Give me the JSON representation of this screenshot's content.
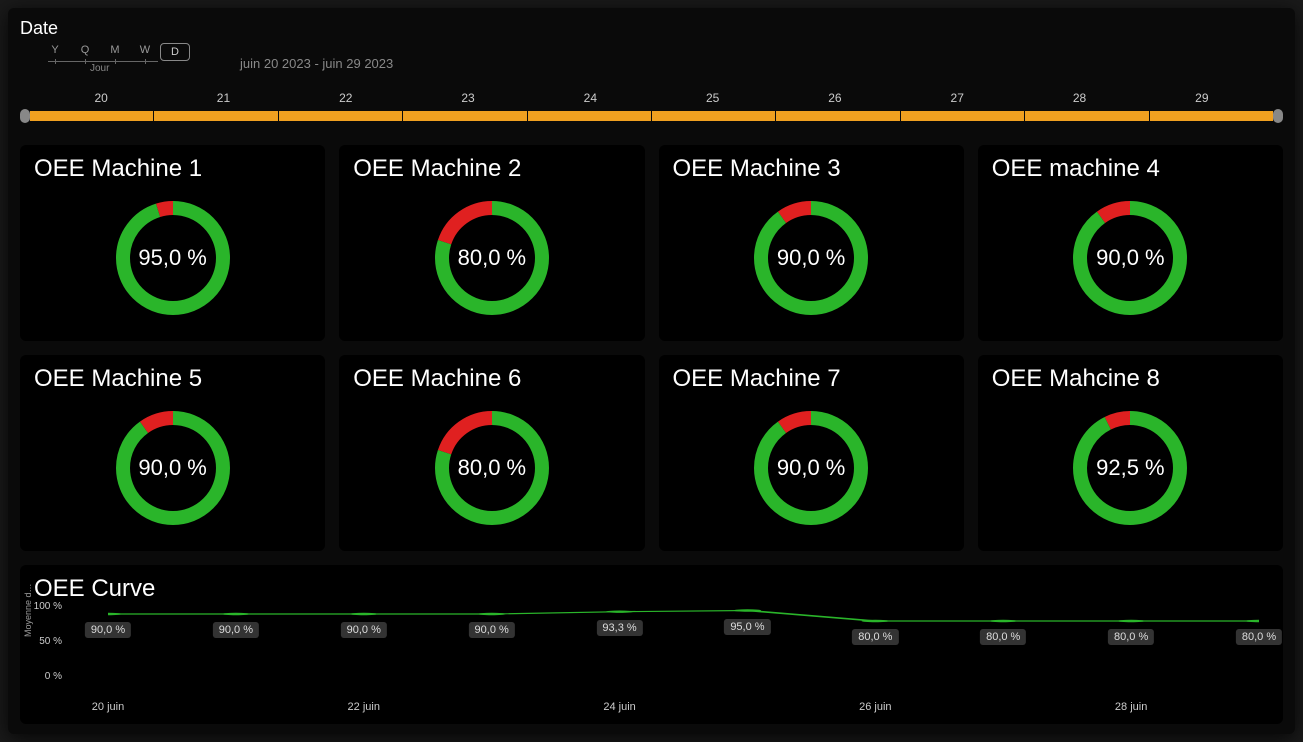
{
  "date_section": {
    "title": "Date",
    "granularity": [
      "Y",
      "Q",
      "M",
      "W",
      "D"
    ],
    "granularity_active": "D",
    "granularity_label": "Jour",
    "range_text": "juin 20 2023 - juin 29 2023",
    "timeline_days": [
      "20",
      "21",
      "22",
      "23",
      "24",
      "25",
      "26",
      "27",
      "28",
      "29"
    ]
  },
  "gauges": [
    {
      "title": "OEE Machine 1",
      "value": 95.0,
      "display": "95,0 %"
    },
    {
      "title": "OEE Machine 2",
      "value": 80.0,
      "display": "80,0 %"
    },
    {
      "title": "OEE Machine 3",
      "value": 90.0,
      "display": "90,0 %"
    },
    {
      "title": "OEE machine 4",
      "value": 90.0,
      "display": "90,0 %"
    },
    {
      "title": "OEE Machine 5",
      "value": 90.0,
      "display": "90,0 %"
    },
    {
      "title": "OEE Machine 6",
      "value": 80.0,
      "display": "80,0 %"
    },
    {
      "title": "OEE Machine 7",
      "value": 90.0,
      "display": "90,0 %"
    },
    {
      "title": "OEE Mahcine 8",
      "value": 92.5,
      "display": "92,5 %"
    }
  ],
  "curve": {
    "title": "OEE Curve",
    "ylabel": "Moyenne d…",
    "yticks": [
      {
        "label": "100 %",
        "value": 100
      },
      {
        "label": "50 %",
        "value": 50
      },
      {
        "label": "0 %",
        "value": 0
      }
    ],
    "xticks": [
      "20 juin",
      "22 juin",
      "24 juin",
      "26 juin",
      "28 juin"
    ]
  },
  "chart_data": {
    "gauges": [
      {
        "type": "donut",
        "title": "OEE Machine 1",
        "value": 95.0,
        "max": 100,
        "colors": {
          "fill": "#2ab52a",
          "remain": "#e02020"
        }
      },
      {
        "type": "donut",
        "title": "OEE Machine 2",
        "value": 80.0,
        "max": 100,
        "colors": {
          "fill": "#2ab52a",
          "remain": "#e02020"
        }
      },
      {
        "type": "donut",
        "title": "OEE Machine 3",
        "value": 90.0,
        "max": 100,
        "colors": {
          "fill": "#2ab52a",
          "remain": "#e02020"
        }
      },
      {
        "type": "donut",
        "title": "OEE machine 4",
        "value": 90.0,
        "max": 100,
        "colors": {
          "fill": "#2ab52a",
          "remain": "#e02020"
        }
      },
      {
        "type": "donut",
        "title": "OEE Machine 5",
        "value": 90.0,
        "max": 100,
        "colors": {
          "fill": "#2ab52a",
          "remain": "#e02020"
        }
      },
      {
        "type": "donut",
        "title": "OEE Machine 6",
        "value": 80.0,
        "max": 100,
        "colors": {
          "fill": "#2ab52a",
          "remain": "#e02020"
        }
      },
      {
        "type": "donut",
        "title": "OEE Machine 7",
        "value": 90.0,
        "max": 100,
        "colors": {
          "fill": "#2ab52a",
          "remain": "#e02020"
        }
      },
      {
        "type": "donut",
        "title": "OEE Mahcine 8",
        "value": 92.5,
        "max": 100,
        "colors": {
          "fill": "#2ab52a",
          "remain": "#e02020"
        }
      }
    ],
    "line": {
      "type": "line",
      "title": "OEE Curve",
      "xlabel": "",
      "ylabel": "Moyenne d…",
      "ylim": [
        0,
        100
      ],
      "x": [
        "20 juin",
        "21 juin",
        "22 juin",
        "23 juin",
        "24 juin",
        "25 juin",
        "26 juin",
        "27 juin",
        "28 juin",
        "29 juin"
      ],
      "series": [
        {
          "name": "OEE",
          "values": [
            90.0,
            90.0,
            90.0,
            90.0,
            93.3,
            95.0,
            80.0,
            80.0,
            80.0,
            80.0
          ],
          "labels": [
            "90,0 %",
            "90,0 %",
            "90,0 %",
            "90,0 %",
            "93,3 %",
            "95,0 %",
            "80,0 %",
            "80,0 %",
            "80,0 %",
            "80,0 %"
          ],
          "color": "#2ab52a"
        }
      ]
    }
  },
  "colors": {
    "accent": "#f0a020",
    "green": "#2ab52a",
    "red": "#e02020",
    "bg": "#0a0a0a"
  }
}
